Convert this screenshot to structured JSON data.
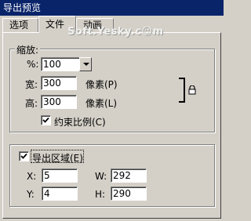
{
  "window": {
    "title": "导出预览"
  },
  "tabs": [
    {
      "label": "选项"
    },
    {
      "label": "文件"
    },
    {
      "label": "动画"
    }
  ],
  "watermark": "Soft.Yesky.c☺m",
  "scale_group": {
    "legend": "缩放:",
    "percent_label": "%:",
    "percent_value": "100",
    "width_label": "宽:",
    "width_value": "300",
    "width_unit": "像素(P)",
    "height_label": "高:",
    "height_value": "300",
    "height_unit": "像素(L)",
    "constrain_label": "约束比例(C)",
    "constrain_checked": true,
    "lock_icon": "lock-icon"
  },
  "export_group": {
    "legend": "导出区域(E)",
    "checked": true,
    "x_label": "X:",
    "x_value": "5",
    "y_label": "Y:",
    "y_value": "4",
    "w_label": "W:",
    "w_value": "292",
    "h_label": "H:",
    "h_value": "290"
  }
}
